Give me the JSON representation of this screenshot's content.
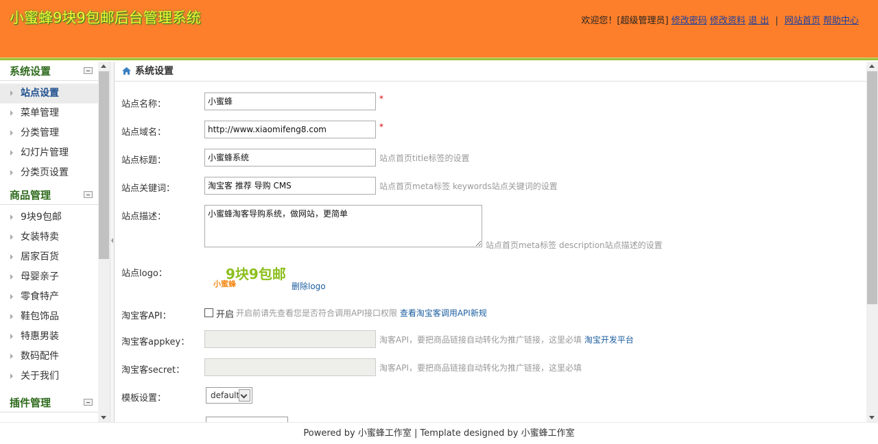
{
  "header": {
    "title": "小蜜蜂9块9包邮后台管理系统",
    "welcome": "欢迎您！[超级管理员]",
    "links": [
      "修改密码",
      "修改资料",
      "退 出"
    ],
    "site_links": [
      "网站首页",
      "帮助中心"
    ],
    "separator": "|"
  },
  "sidebar": {
    "groups": [
      {
        "title": "系统设置",
        "items": [
          "站点设置",
          "菜单管理",
          "分类管理",
          "幻灯片管理",
          "分类页设置"
        ]
      },
      {
        "title": "商品管理",
        "items": [
          "9块9包邮",
          "女装特卖",
          "居家百货",
          "母婴亲子",
          "零食特产",
          "鞋包饰品",
          "特惠男装",
          "数码配件",
          "关于我们"
        ]
      },
      {
        "title": "插件管理",
        "items": []
      }
    ],
    "active_item": "站点设置"
  },
  "main": {
    "heading": "系统设置",
    "fields": {
      "site_name": {
        "label": "站点名称：",
        "value": "小蜜蜂",
        "required": "*"
      },
      "site_domain": {
        "label": "站点域名：",
        "value": "http://www.xiaomifeng8.com",
        "required": "*"
      },
      "site_title": {
        "label": "站点标题：",
        "value": "小蜜蜂系统",
        "hint": "站点首页title标签的设置"
      },
      "site_keywords": {
        "label": "站点关键词：",
        "value": "淘宝客 推荐 导购 CMS",
        "hint": "站点首页meta标签 keywords站点关键词的设置"
      },
      "site_desc": {
        "label": "站点描述：",
        "value": "小蜜蜂淘客导购系统，做网站，更简单",
        "hint": "站点首页meta标签 description站点描述的设置"
      },
      "site_logo": {
        "label": "站点logo：",
        "logo_main": "9块9包邮",
        "logo_sub": "小蜜蜂",
        "delete": "删除logo"
      },
      "tbk_api": {
        "label": "淘宝客API：",
        "checkbox_label": "开启",
        "hint": "开启前请先查看您是否符合调用API接口权限",
        "link": "查看淘宝客调用API新规"
      },
      "appkey": {
        "label": "淘宝客appkey：",
        "hint": "淘客API，要把商品链接自动转化为推广链接，这里必填",
        "link": "淘宝开发平台"
      },
      "secret": {
        "label": "淘宝客secret：",
        "hint": "淘客API，要把商品链接自动转化为推广链接，这里必填"
      },
      "template": {
        "label": "模板设置：",
        "value": "default"
      }
    }
  },
  "footer": {
    "text": "Powered by 小蜜蜂工作室 | Template designed by 小蜜蜂工作室"
  },
  "colors": {
    "header_bg": "#fd7f2b",
    "accent_line": "#9cc03a",
    "title_text": "#f5f535",
    "link": "#1a3fa0"
  }
}
